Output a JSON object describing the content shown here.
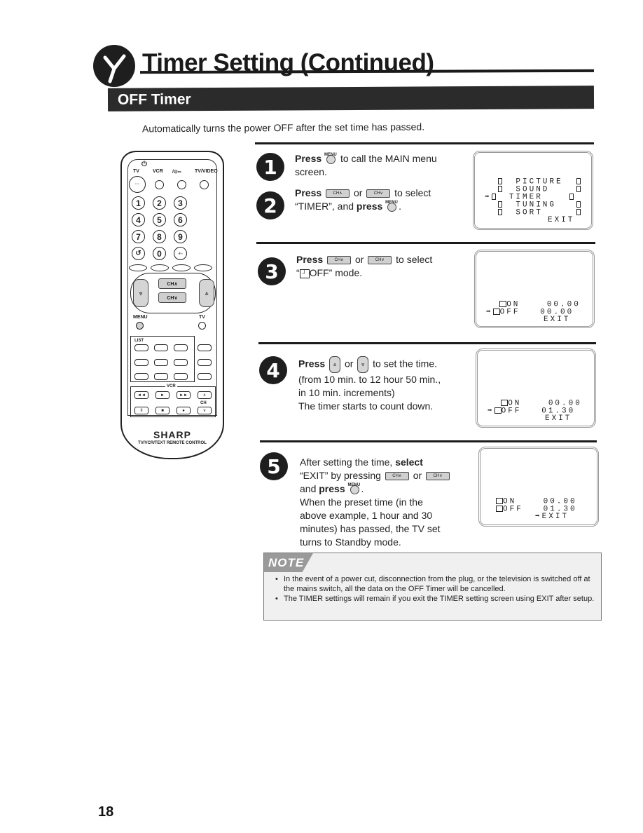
{
  "header": {
    "title": "Timer Setting (Continued)",
    "icon": "clock-y-icon"
  },
  "section": {
    "title": "OFF Timer",
    "intro": "Automatically turns the power OFF after the set time has passed."
  },
  "remote": {
    "power_label": "TV",
    "vcr_label": "VCR",
    "text_label": "/⊙∞",
    "tvvideo_label": "TV/VIDEO",
    "power_symbol": "⏻",
    "numbers": [
      "1",
      "2",
      "3",
      "4",
      "5",
      "6",
      "7",
      "8",
      "9",
      "↺",
      "0",
      "-/--"
    ],
    "ch_up": "CH∧",
    "ch_down": "CH∨",
    "menu_label": "MENU",
    "tv_label": "TV",
    "list_label": "LIST",
    "vcr_section": "VCR",
    "ch_small": "CH",
    "vcr_keys": [
      "◄◄",
      "►",
      "►►",
      "∧",
      "II",
      "■",
      "●",
      "∨"
    ],
    "brand": "SHARP",
    "brand_sub": "TV/VCR/TEXT REMOTE CONTROL"
  },
  "buttons": {
    "menu_tag": "MENU",
    "ch_up": "CH∧",
    "ch_down": "CH∨",
    "vol_up": "⩓",
    "vol_down": "⩔"
  },
  "steps": [
    {
      "number": "1",
      "press": "Press",
      "text_after": "to call the MAIN menu",
      "text_line2": "screen."
    },
    {
      "number": "2",
      "press": "Press",
      "or": "or",
      "text_after": "to select",
      "line2_a": "“TIMER”, and",
      "line2_press": "press",
      "line2_end": "."
    },
    {
      "number": "3",
      "press": "Press",
      "or": "or",
      "text_after": "to select",
      "line2_a": "“",
      "line2_b": "OFF” mode."
    },
    {
      "number": "4",
      "press": "Press",
      "or": "or",
      "text_after": "to set the time.",
      "lines": [
        "(from 10 min. to 12 hour 50 min.,",
        "in 10 min. increments)",
        "The timer starts to count down."
      ]
    },
    {
      "number": "5",
      "line1_a": "After setting the time,",
      "line1_b": "select",
      "line2": "“EXIT” by pressing",
      "or": "or",
      "line3_a": "and",
      "line3_b": "press",
      "line3_end": ".",
      "lines": [
        "When the preset time (in the",
        "above example, 1 hour and 30",
        "minutes) has passed, the TV set",
        "turns to Standby mode."
      ]
    }
  ],
  "screens": {
    "main_menu": {
      "items": [
        "PICTURE",
        "SOUND",
        "TIMER",
        "TUNING",
        "SORT"
      ],
      "selected": "TIMER",
      "exit": "EXIT",
      "arrow": "➡"
    },
    "timer_step3": {
      "on_label": "ON",
      "on_time": "00.00",
      "off_label": "OFF",
      "off_time": "00.00",
      "exit": "EXIT",
      "selected": "OFF"
    },
    "timer_step4": {
      "on_label": "ON",
      "on_time": "00.00",
      "off_label": "OFF",
      "off_time": "01.30",
      "exit": "EXIT",
      "selected": "OFF"
    },
    "timer_step5": {
      "on_label": "ON",
      "on_time": "00.00",
      "off_label": "OFF",
      "off_time": "01.30",
      "exit": "EXIT",
      "selected": "EXIT"
    }
  },
  "note": {
    "tag": "NOTE",
    "items": [
      "In the event of a power cut, disconnection from the plug, or the television is switched off at the mains switch, all the data on the OFF Timer will be cancelled.",
      "The TIMER settings will remain if you exit the TIMER setting screen using EXIT after setup."
    ]
  },
  "page_number": "18"
}
